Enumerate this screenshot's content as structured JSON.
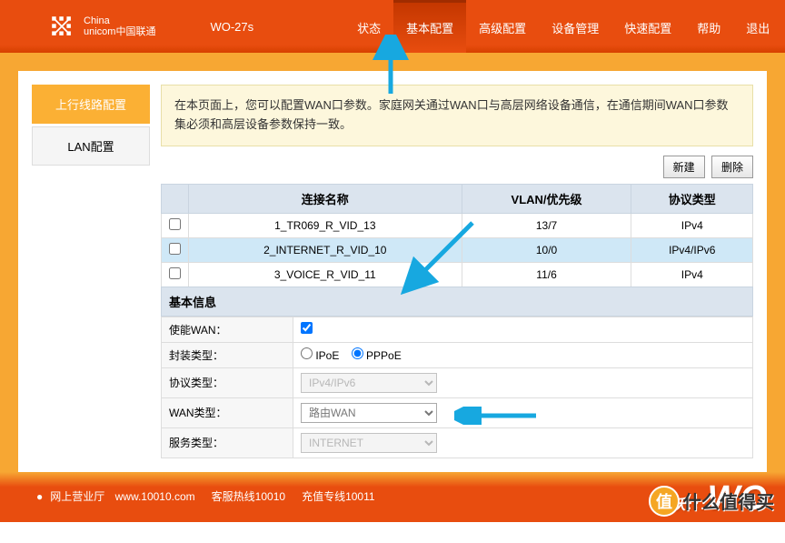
{
  "header": {
    "brand_line1": "China",
    "brand_line2": "unicom中国联通",
    "model": "WO-27s",
    "nav": [
      "状态",
      "基本配置",
      "高级配置",
      "设备管理",
      "快速配置",
      "帮助",
      "退出"
    ],
    "active_nav": 1
  },
  "sidebar": {
    "items": [
      "上行线路配置",
      "LAN配置"
    ],
    "active": 0
  },
  "info_text": "在本页面上，您可以配置WAN口参数。家庭网关通过WAN口与高层网络设备通信，在通信期间WAN口参数集必须和高层设备参数保持一致。",
  "buttons": {
    "new": "新建",
    "delete": "删除"
  },
  "table": {
    "headers": [
      "连接名称",
      "VLAN/优先级",
      "协议类型"
    ],
    "rows": [
      {
        "name": "1_TR069_R_VID_13",
        "vlan": "13/7",
        "proto": "IPv4",
        "selected": false
      },
      {
        "name": "2_INTERNET_R_VID_10",
        "vlan": "10/0",
        "proto": "IPv4/IPv6",
        "selected": true
      },
      {
        "name": "3_VOICE_R_VID_11",
        "vlan": "11/6",
        "proto": "IPv4",
        "selected": false
      }
    ]
  },
  "section_title": "基本信息",
  "form": {
    "enable_wan": {
      "label": "使能WAN：",
      "checked": true
    },
    "encap": {
      "label": "封装类型：",
      "options": [
        "IPoE",
        "PPPoE"
      ],
      "selected": "PPPoE"
    },
    "proto": {
      "label": "协议类型：",
      "value": "IPv4/IPv6"
    },
    "wan_type": {
      "label": "WAN类型：",
      "value": "路由WAN"
    },
    "service": {
      "label": "服务类型：",
      "value": "INTERNET"
    }
  },
  "footer": {
    "link1": "网上营业厅",
    "url": "www.10010.com",
    "hotline": "客服热线10010",
    "recharge": "充值专线10011",
    "wo": "WO"
  },
  "watermark": {
    "circle": "值",
    "text": "什么值得买"
  }
}
